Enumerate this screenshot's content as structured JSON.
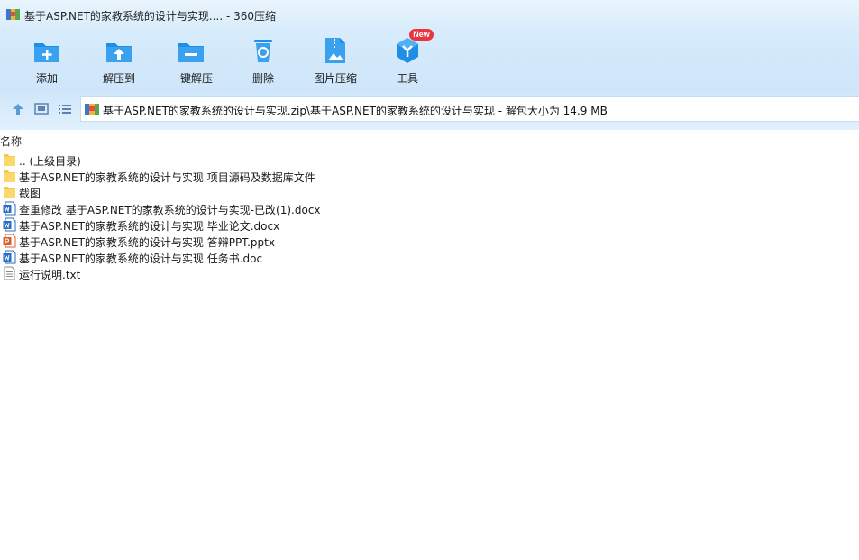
{
  "window": {
    "title": "基于ASP.NET的家教系统的设计与实现.... - 360压缩"
  },
  "toolbar": {
    "items": [
      {
        "label": "添加",
        "icon": "add-icon"
      },
      {
        "label": "解压到",
        "icon": "extract-to-icon"
      },
      {
        "label": "一键解压",
        "icon": "one-click-extract-icon"
      },
      {
        "label": "删除",
        "icon": "delete-icon"
      },
      {
        "label": "图片压缩",
        "icon": "image-compress-icon"
      },
      {
        "label": "工具",
        "icon": "tools-icon",
        "badge": "New"
      }
    ]
  },
  "nav": {
    "path": "基于ASP.NET的家教系统的设计与实现.zip\\基于ASP.NET的家教系统的设计与实现 - 解包大小为 14.9 MB"
  },
  "list": {
    "column_name": "名称",
    "files": [
      {
        "name": ".. (上级目录)",
        "type": "folder"
      },
      {
        "name": "基于ASP.NET的家教系统的设计与实现 项目源码及数据库文件",
        "type": "folder"
      },
      {
        "name": "截图",
        "type": "folder"
      },
      {
        "name": "查重修改 基于ASP.NET的家教系统的设计与实现-已改(1).docx",
        "type": "word"
      },
      {
        "name": "基于ASP.NET的家教系统的设计与实现 毕业论文.docx",
        "type": "word"
      },
      {
        "name": "基于ASP.NET的家教系统的设计与实现 答辩PPT.pptx",
        "type": "ppt"
      },
      {
        "name": "基于ASP.NET的家教系统的设计与实现 任务书.doc",
        "type": "word"
      },
      {
        "name": "运行说明.txt",
        "type": "txt"
      }
    ]
  },
  "colors": {
    "accent": "#1f8ee6",
    "folder": "#f6c94e",
    "word": "#2b6cc4",
    "ppt": "#d9622b"
  }
}
